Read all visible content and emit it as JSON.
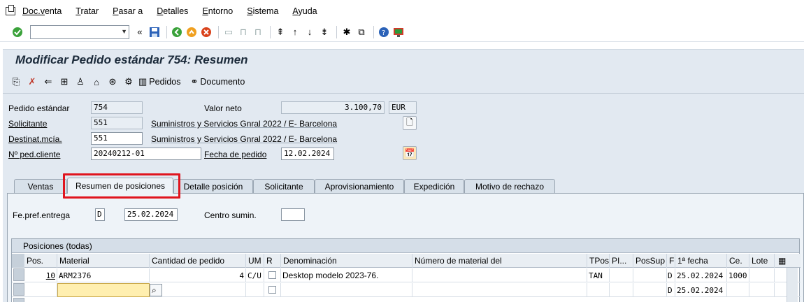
{
  "menu": [
    "Doc.venta",
    "Tratar",
    "Pasar a",
    "Detalles",
    "Entorno",
    "Sistema",
    "Ayuda"
  ],
  "menu_underline": [
    "Doc.v",
    "T",
    "P",
    "D",
    "E",
    "S",
    "A"
  ],
  "title": "Modificar Pedido estándar 754: Resumen",
  "app_toolbar": {
    "orders_label": "Pedidos",
    "document_label": "Documento"
  },
  "header": {
    "pedido_label": "Pedido estándar",
    "pedido_value": "754",
    "valor_neto_label": "Valor neto",
    "valor_neto_value": "3.100,70",
    "currency": "EUR",
    "solicitante_label": "Solicitante",
    "solicitante_value": "551",
    "solicitante_name": "Suministros y Servicios Gnral 2022 / E- Barcelona",
    "destinat_label": "Destinat.mcía.",
    "destinat_value": "551",
    "destinat_name": "Suministros y Servicios Gnral 2022 / E- Barcelona",
    "ped_cliente_label": "Nº ped.cliente",
    "ped_cliente_value": "20240212-01",
    "fecha_pedido_label": "Fecha de pedido",
    "fecha_pedido_value": "12.02.2024"
  },
  "tabs": [
    "Ventas",
    "Resumen de posiciones",
    "Detalle posición",
    "Solicitante",
    "Aprovisionamiento",
    "Expedición",
    "Motivo de rechazo"
  ],
  "active_tab": "Resumen de posiciones",
  "panel": {
    "fe_pref_label": "Fe.pref.entrega",
    "fe_pref_unit": "D",
    "fe_pref_value": "25.02.2024",
    "centro_label": "Centro sumin.",
    "centro_value": ""
  },
  "table": {
    "title": "Posiciones (todas)",
    "columns": [
      "Pos.",
      "Material",
      "Cantidad de pedido",
      "UM",
      "R",
      "Denominación",
      "Número de material del",
      "TPos",
      "PI...",
      "PosSup",
      "F",
      "1ª fecha",
      "Ce.",
      "Lote"
    ],
    "rows": [
      {
        "pos": "10",
        "material": "ARM2376",
        "cantidad": "4",
        "um": "C/U",
        "denominacion": "Desktop modelo 2023-76.",
        "num_mat": "",
        "tpos": "TAN",
        "pi": "",
        "possup": "",
        "f": "D",
        "fecha": "25.02.2024",
        "ce": "1000",
        "lote": ""
      },
      {
        "pos": "",
        "material": "",
        "cantidad": "",
        "um": "",
        "denominacion": "",
        "num_mat": "",
        "tpos": "",
        "pi": "",
        "possup": "",
        "f": "D",
        "fecha": "25.02.2024",
        "ce": "",
        "lote": ""
      }
    ]
  },
  "colors": {
    "highlight": "#e0141e",
    "background": "#e2e9f1"
  }
}
